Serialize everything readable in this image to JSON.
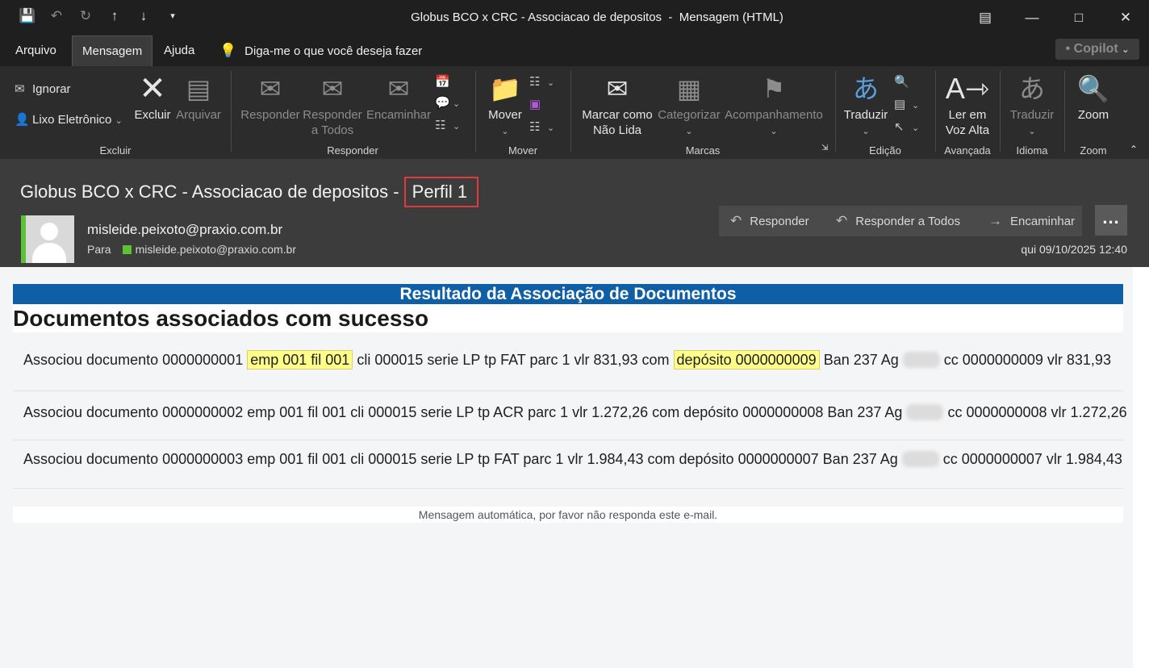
{
  "window": {
    "title": "Globus BCO x CRC - Associacao de depositos  -  Mensagem (HTML)",
    "qat_icons": [
      "save-icon",
      "undo-icon",
      "redo-icon",
      "up-arrow-icon",
      "down-arrow-icon",
      "customize-qat-icon"
    ],
    "controls": [
      "restore-icon",
      "minimize-icon",
      "maximize-icon",
      "close-icon"
    ]
  },
  "tabs": {
    "arquivo": "Arquivo",
    "mensagem": "Mensagem",
    "ajuda": "Ajuda",
    "tellme": "Diga-me o que você deseja fazer",
    "copilot": "Copilot"
  },
  "ribbon": {
    "excluir_group": {
      "ignorar": "Ignorar",
      "lixo": "Lixo Eletrônico",
      "excluir": "Excluir",
      "arquivar": "Arquivar",
      "label": "Excluir"
    },
    "responder_group": {
      "responder": "Responder",
      "responder_todos_1": "Responder",
      "responder_todos_2": "a Todos",
      "encaminhar": "Encaminhar",
      "label": "Responder"
    },
    "mover_group": {
      "mover": "Mover",
      "label": "Mover"
    },
    "marcas_group": {
      "marcar_1": "Marcar como",
      "marcar_2": "Não Lida",
      "categorizar": "Categorizar",
      "acompanhamento": "Acompanhamento",
      "label": "Marcas"
    },
    "edicao_group": {
      "traduzir": "Traduzir",
      "label": "Edição"
    },
    "avancada_group": {
      "ler_1": "Ler em",
      "ler_2": "Voz Alta",
      "label": "Avançada"
    },
    "idioma_group": {
      "traduzir": "Traduzir",
      "label": "Idioma"
    },
    "zoom_group": {
      "zoom": "Zoom",
      "label": "Zoom"
    }
  },
  "message": {
    "subject_prefix": "Globus BCO x CRC - Associacao de depositos - ",
    "subject_highlight": "Perfil 1",
    "sender": "misleide.peixoto@praxio.com.br",
    "to_label": "Para",
    "to_address": "misleide.peixoto@praxio.com.br",
    "date": "qui 09/10/2025 12:40",
    "actions": {
      "responder": "Responder",
      "responder_todos": "Responder a Todos",
      "encaminhar": "Encaminhar",
      "more": "..."
    }
  },
  "body": {
    "banner": "Resultado da Associação de Documentos",
    "heading": "Documentos associados com sucesso",
    "rows": [
      {
        "a": "Associou documento 0000000001 ",
        "hl1": "emp 001 fil 001",
        "b": " cli 000015 serie LP tp FAT parc 1 vlr 831,93 com ",
        "hl2": "depósito 0000000009",
        "c": " Ban 237 Ag ",
        "d": " cc 0000000009 vlr 831,93"
      },
      {
        "a": "Associou documento 0000000002 emp 001 fil 001 cli 000015 serie LP tp ACR parc 1 vlr 1.272,26 com depósito 0000000008 Ban 237 Ag ",
        "d": " cc 0000000008 vlr 1.272,26"
      },
      {
        "a": "Associou documento 0000000003 emp 001 fil 001 cli 000015 serie LP tp FAT parc 1 vlr 1.984,43 com depósito 0000000007 Ban 237 Ag ",
        "d": " cc 0000000007 vlr 1.984,43"
      }
    ],
    "footer": "Mensagem automática, por favor não responda este e-mail."
  }
}
